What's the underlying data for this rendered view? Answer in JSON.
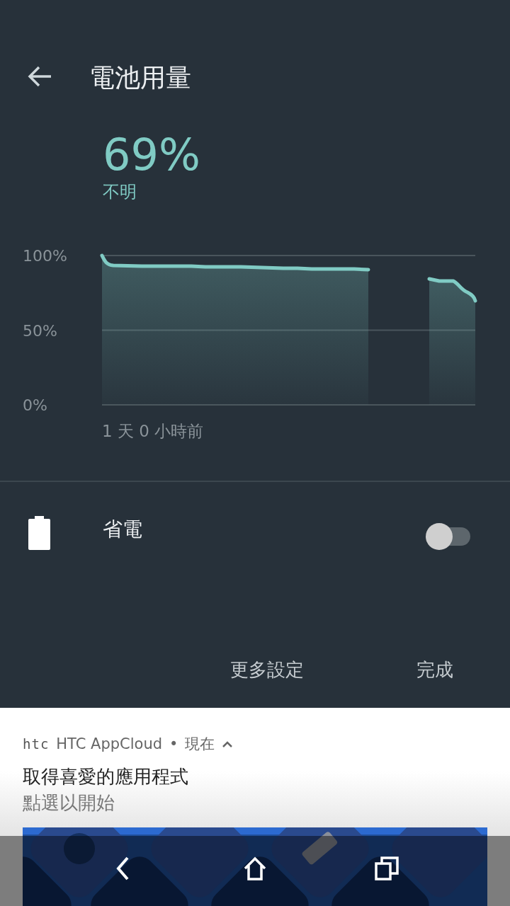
{
  "header": {
    "title": "電池用量"
  },
  "battery": {
    "percent": "69%",
    "status": "不明"
  },
  "chart": {
    "y_labels": [
      "100%",
      "50%",
      "0%"
    ],
    "time_label": "1 天 0 小時前"
  },
  "battery_saver": {
    "label": "省電",
    "on": false
  },
  "actions": [
    "更多設定",
    "完成"
  ],
  "notification": {
    "logo": "htc",
    "app": "HTC AppCloud",
    "separator": "•",
    "time": "現在",
    "title": "取得喜愛的應用程式",
    "text": "點選以開始"
  }
}
